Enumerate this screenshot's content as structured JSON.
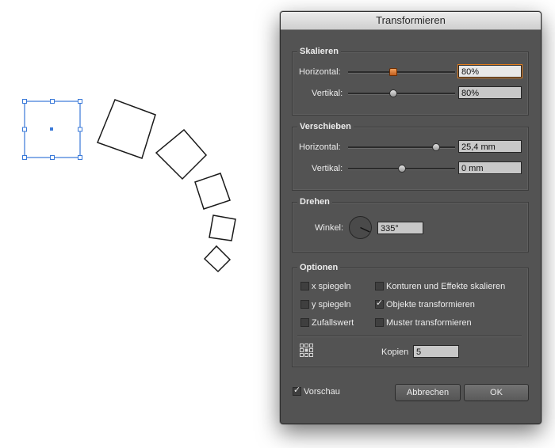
{
  "dialog": {
    "title": "Transformieren"
  },
  "scale": {
    "title": "Skalieren",
    "horizontal_label": "Horizontal:",
    "horizontal_value": "80%",
    "horizontal_slider_level": 0.42,
    "vertical_label": "Vertikal:",
    "vertical_value": "80%",
    "vertical_slider_level": 0.42
  },
  "move": {
    "title": "Verschieben",
    "horizontal_label": "Horizontal:",
    "horizontal_value": "25,4 mm",
    "horizontal_slider_level": 0.82,
    "vertical_label": "Vertikal:",
    "vertical_value": "0 mm",
    "vertical_slider_level": 0.5
  },
  "rotate": {
    "title": "Drehen",
    "angle_label": "Winkel:",
    "angle_value": "335°",
    "angle_degrees": 335
  },
  "options": {
    "title": "Optionen",
    "flip_x": {
      "label": "x spiegeln",
      "checked": false
    },
    "flip_y": {
      "label": "y spiegeln",
      "checked": false
    },
    "random": {
      "label": "Zufallswert",
      "checked": false
    },
    "scale_strokes": {
      "label": "Konturen und Effekte skalieren",
      "checked": false
    },
    "transform_objects": {
      "label": "Objekte transformieren",
      "checked": true
    },
    "transform_patterns": {
      "label": "Muster transformieren",
      "checked": false
    },
    "copies_label": "Kopien",
    "copies_value": "5",
    "reference_point_icon": "reference-point-grid-icon"
  },
  "preview": {
    "label": "Vorschau",
    "checked": true
  },
  "buttons": {
    "cancel": "Abbrechen",
    "ok": "OK"
  },
  "colors": {
    "selection": "#3a79d8",
    "panel": "#535353",
    "focus": "#e07a1a"
  }
}
